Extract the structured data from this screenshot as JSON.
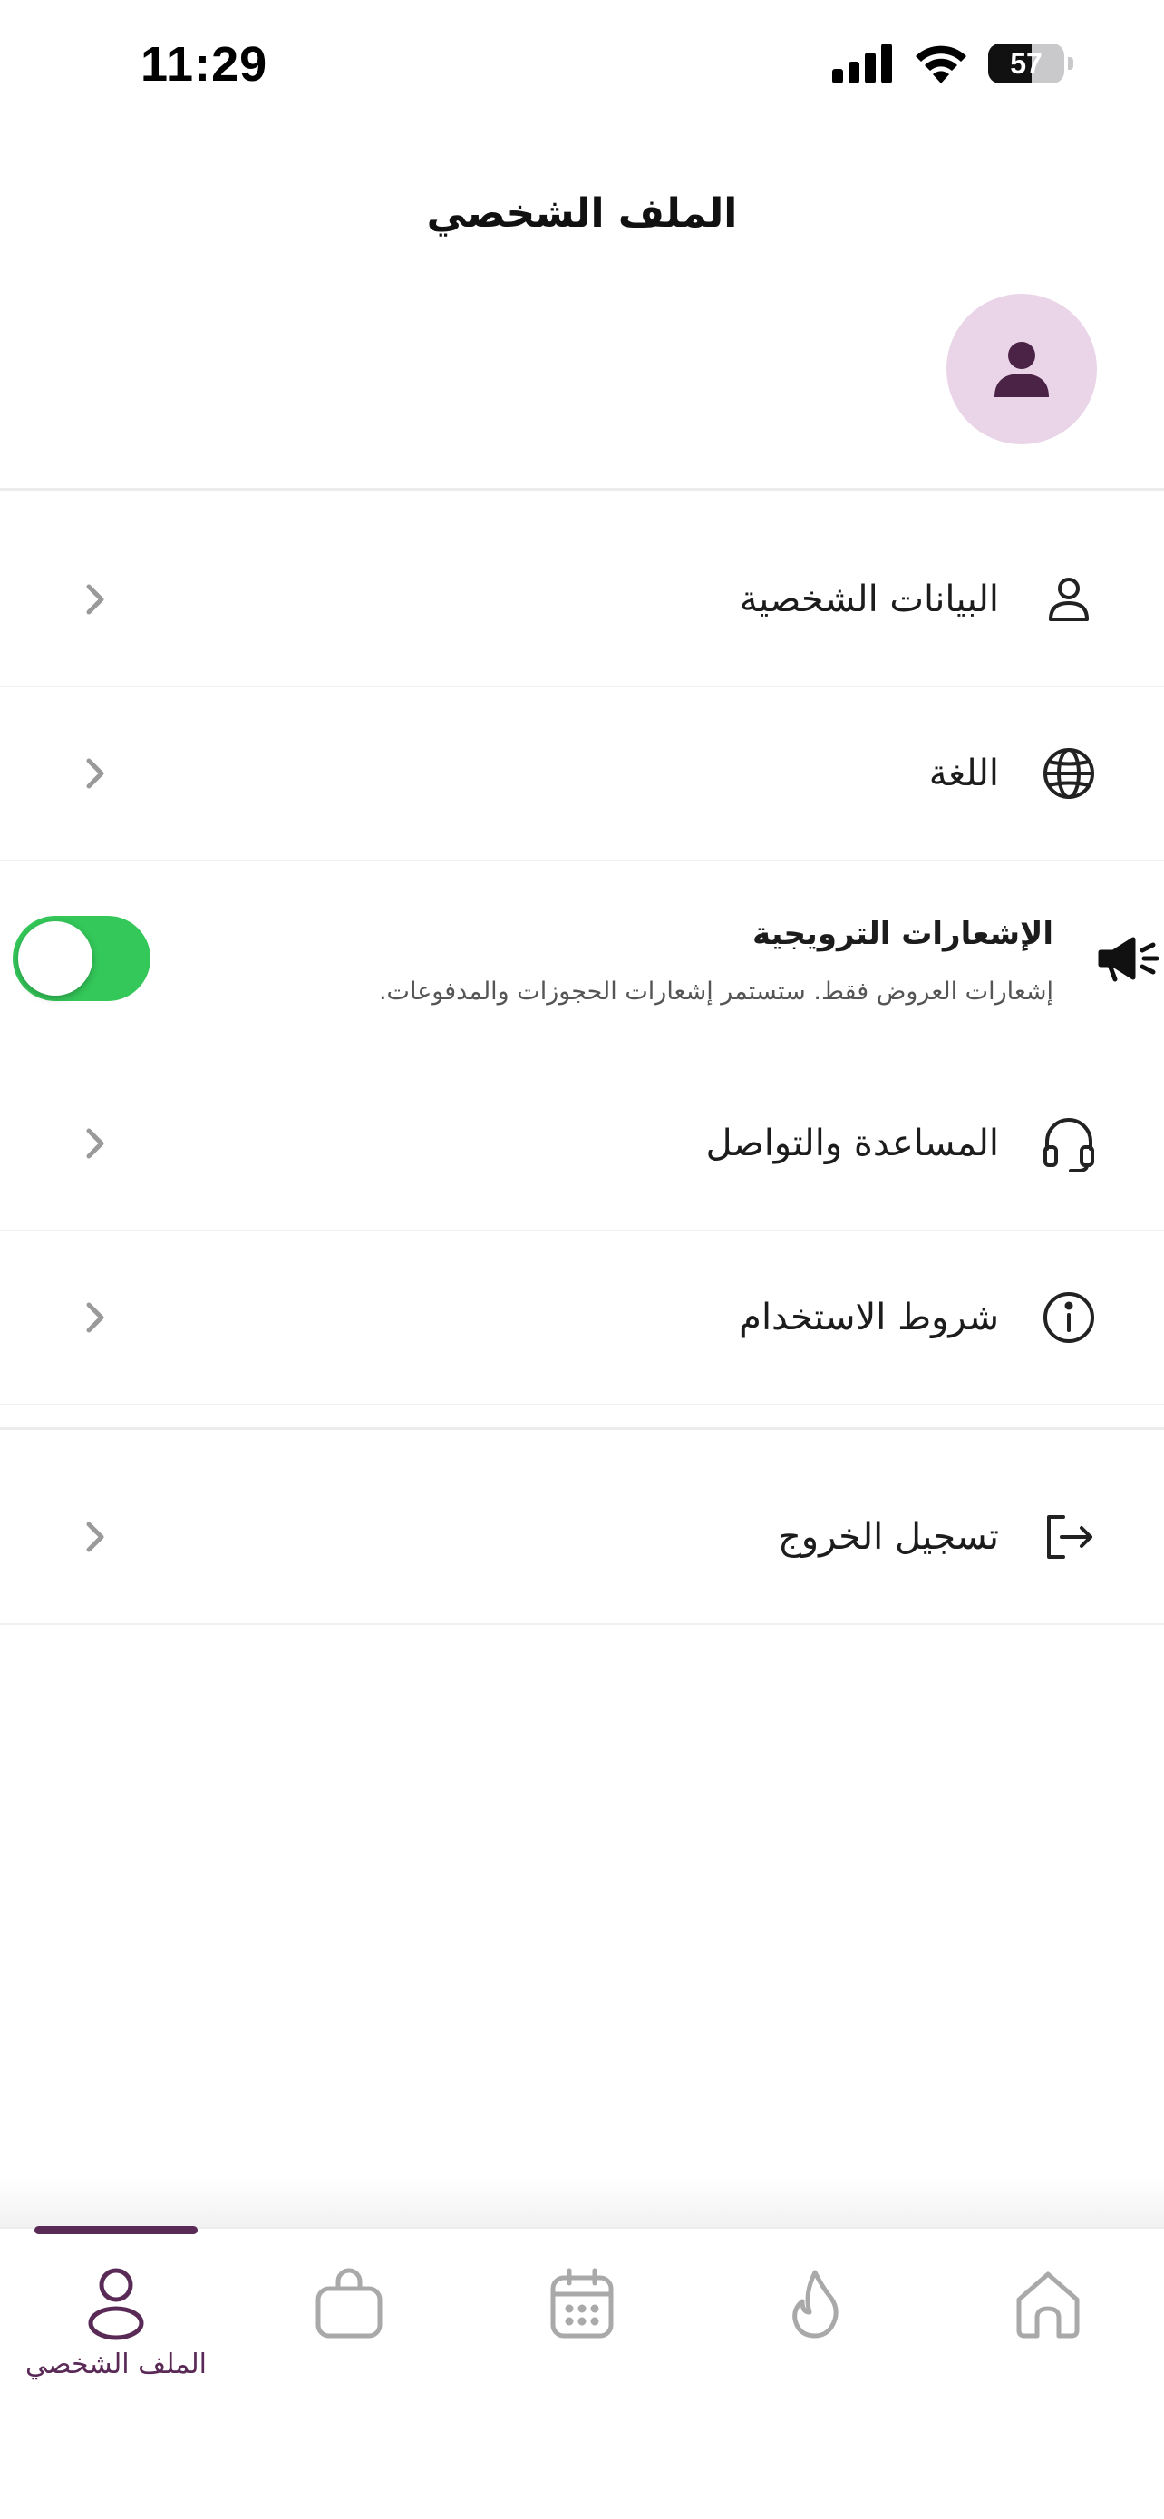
{
  "status_bar": {
    "time": "11:29",
    "battery_level": "57",
    "battery_fraction": 0.57
  },
  "header": {
    "title": "الملف الشخصي"
  },
  "menu": {
    "personal_data": "البيانات الشخصية",
    "language": "اللغة",
    "promo_notifications": {
      "title": "الإشعارات الترويجية",
      "subtitle": "إشعارات العروض فقط. ستستمر إشعارات الحجوزات والمدفوعات.",
      "enabled": true
    },
    "help_support": "المساعدة والتواصل",
    "terms_of_use": "شروط الاستخدام",
    "logout": "تسجيل الخروج"
  },
  "bottom_nav": {
    "active": "profile",
    "items": [
      {
        "id": "profile",
        "label": "الملف الشخصي",
        "icon": "person-icon"
      },
      {
        "id": "bag",
        "label": "",
        "icon": "bag-icon"
      },
      {
        "id": "calendar",
        "label": "",
        "icon": "calendar-icon"
      },
      {
        "id": "fire",
        "label": "",
        "icon": "flame-icon"
      },
      {
        "id": "home",
        "label": "",
        "icon": "home-icon"
      }
    ]
  },
  "colors": {
    "accent": "#5a2a57",
    "avatar_bg": "#ead4e8",
    "toggle_on": "#34c759",
    "inactive_icon": "#a9a9a9"
  }
}
